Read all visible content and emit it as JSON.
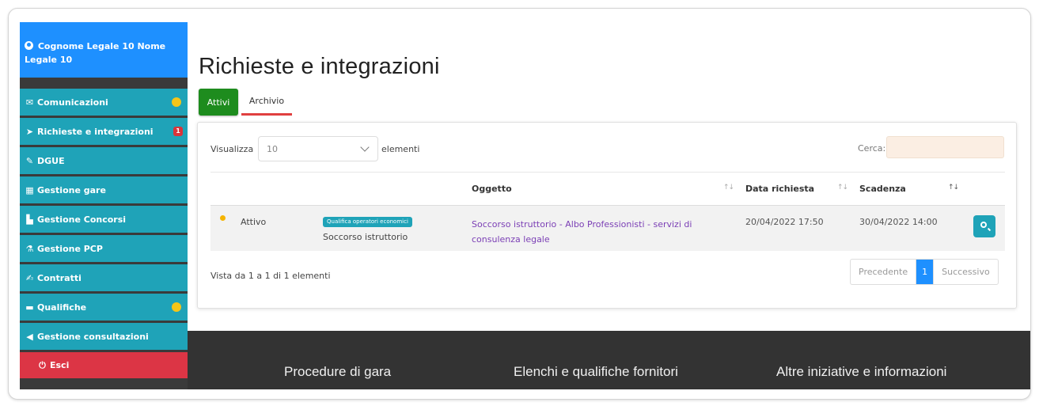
{
  "user": {
    "name": "Cognome Legale 10 Nome Legale 10"
  },
  "sidebar": {
    "items": [
      {
        "label": "Comunicazioni",
        "icon": "envelope-icon",
        "glyph": "✉",
        "indicator": "dot"
      },
      {
        "label": "Richieste e integrazioni",
        "icon": "paper-plane-icon",
        "glyph": "➤",
        "indicator": "badge",
        "badge": "1"
      },
      {
        "label": "DGUE",
        "icon": "edit-icon",
        "glyph": "✎"
      },
      {
        "label": "Gestione gare",
        "icon": "briefcase-icon",
        "glyph": "▦"
      },
      {
        "label": "Gestione Concorsi",
        "icon": "chart-icon",
        "glyph": "▙"
      },
      {
        "label": "Gestione PCP",
        "icon": "flask-icon",
        "glyph": "⚗"
      },
      {
        "label": "Contratti",
        "icon": "pencil-square-icon",
        "glyph": "✍"
      },
      {
        "label": "Qualifiche",
        "icon": "folder-icon",
        "glyph": "▬",
        "indicator": "dot"
      },
      {
        "label": "Gestione consultazioni",
        "icon": "megaphone-icon",
        "glyph": "◀"
      }
    ],
    "logout": "Esci"
  },
  "page": {
    "title": "Richieste e integrazioni",
    "tabs": {
      "active": "Attivi",
      "archive": "Archivio"
    }
  },
  "table": {
    "show_label": "Visualizza",
    "page_size": "10",
    "elements_label": "elementi",
    "search_label": "Cerca:",
    "columns": {
      "oggetto": "Oggetto",
      "data": "Data richiesta",
      "scadenza": "Scadenza"
    },
    "rows": [
      {
        "status": "Attivo",
        "tag": "Qualifica operatori economici",
        "type": "Soccorso istruttorio",
        "oggetto": "Soccorso istruttorio - Albo Professionisti - servizi di consulenza legale",
        "data": "20/04/2022 17:50",
        "scadenza": "30/04/2022 14:00"
      }
    ],
    "info": "Vista da 1 a 1 di 1 elementi",
    "pager": {
      "prev": "Precedente",
      "current": "1",
      "next": "Successivo"
    }
  },
  "footer": {
    "links": [
      "Procedure di gara",
      "Elenchi e qualifiche fornitori",
      "Altre iniziative e informazioni"
    ]
  },
  "colors": {
    "sidebar_item": "#1fa3b8",
    "user_box": "#1e90ff",
    "logout": "#dc3545",
    "active_tab": "#1e8c1e",
    "link": "#7b3fb5",
    "footer": "#333333"
  }
}
